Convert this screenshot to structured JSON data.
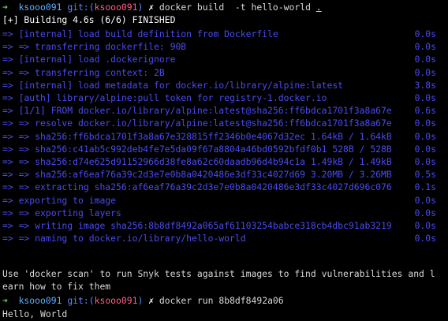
{
  "prompt1": {
    "arrow": "➜",
    "user": "ksooo091",
    "git_label": "git:(",
    "branch": "ksooo091",
    "git_close": ")",
    "cross": "✗",
    "cmd_prefix": "docker build  -t hello-world ",
    "cmd_dot": "."
  },
  "build_header": "[+] Building 4.6s (6/6) FINISHED",
  "build_steps": [
    {
      "text": "=> [internal] load build definition from Dockerfile",
      "time": "0.0s"
    },
    {
      "text": "=> => transferring dockerfile: 90B",
      "time": "0.0s"
    },
    {
      "text": "=> [internal] load .dockerignore",
      "time": "0.0s"
    },
    {
      "text": "=> => transferring context: 2B",
      "time": "0.0s"
    },
    {
      "text": "=> [internal] load metadata for docker.io/library/alpine:latest",
      "time": "3.8s"
    },
    {
      "text": "=> [auth] library/alpine:pull token for registry-1.docker.io",
      "time": "0.0s"
    },
    {
      "text": "=> [1/1] FROM docker.io/library/alpine:latest@sha256:ff6bdca1701f3a8a67e",
      "time": "0.6s"
    },
    {
      "text": "=> => resolve docker.io/library/alpine:latest@sha256:ff6bdca1701f3a8a67e",
      "time": "0.0s"
    },
    {
      "text": "=> => sha256:ff6bdca1701f3a8a67e328815ff2346b0e4067d32ec 1.64kB / 1.64kB",
      "time": "0.0s"
    },
    {
      "text": "=> => sha256:c41ab5c992deb4fe7e5da09f67a8804a46bd0592bfdf0b1 528B / 528B",
      "time": "0.0s"
    },
    {
      "text": "=> => sha256:d74e625d91152966d38fe8a62c60daadb96d4b94c1a 1.49kB / 1.49kB",
      "time": "0.0s"
    },
    {
      "text": "=> => sha256:af6eaf76a39c2d3e7e0b8a0420486e3df33c4027d69 3.20MB / 3.26MB",
      "time": "0.5s"
    },
    {
      "text": "=> => extracting sha256:af6eaf76a39c2d3e7e0b8a0420486e3df33c4027d696c076",
      "time": "0.1s"
    },
    {
      "text": "=> exporting to image",
      "time": "0.0s"
    },
    {
      "text": "=> => exporting layers",
      "time": "0.0s"
    },
    {
      "text": "=> => writing image sha256:8b8df8492a065af61103254babce318cb4dbc91ab3219",
      "time": "0.0s"
    },
    {
      "text": "=> => naming to docker.io/library/hello-world",
      "time": "0.0s"
    }
  ],
  "scan_msg_line1": "Use 'docker scan' to run Snyk tests against images to find vulnerabilities and l",
  "scan_msg_line2": "earn how to fix them",
  "prompt2": {
    "arrow": "➜",
    "user": "ksooo091",
    "git_label": "git:(",
    "branch": "ksooo091",
    "git_close": ")",
    "cross": "✗",
    "cmd_prefix": "docker run 8b8df8492a06"
  },
  "output": "Hello, World"
}
